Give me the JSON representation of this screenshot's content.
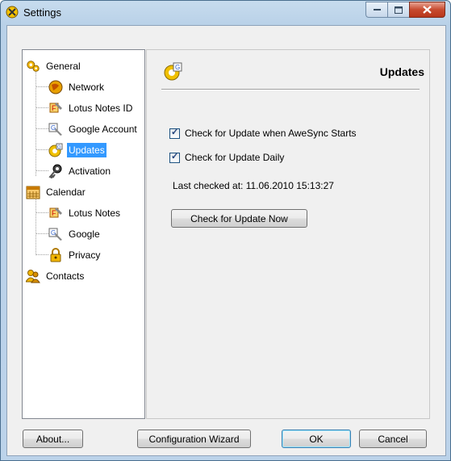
{
  "window": {
    "title": "Settings"
  },
  "caption": {
    "minimize": "–",
    "maximize": "□",
    "close": "✕"
  },
  "tree": {
    "items": [
      {
        "label": "General",
        "icon": "gears-icon"
      },
      {
        "label": "Network",
        "icon": "globe-icon"
      },
      {
        "label": "Lotus Notes ID",
        "icon": "lotus-tools-icon"
      },
      {
        "label": "Google Account",
        "icon": "google-tools-icon"
      },
      {
        "label": "Updates",
        "icon": "update-gear-icon",
        "selected": true
      },
      {
        "label": "Activation",
        "icon": "key-icon"
      },
      {
        "label": "Calendar",
        "icon": "calendar-icon"
      },
      {
        "label": "Lotus Notes",
        "icon": "lotus-tools-icon"
      },
      {
        "label": "Google",
        "icon": "google-tools-icon"
      },
      {
        "label": "Privacy",
        "icon": "lock-icon"
      },
      {
        "label": "Contacts",
        "icon": "contacts-icon"
      }
    ]
  },
  "panel": {
    "title": "Updates",
    "check_on_start": {
      "label": "Check for Update when AweSync Starts",
      "checked": true
    },
    "check_daily": {
      "label": "Check for Update Daily",
      "checked": true
    },
    "last_checked": "Last checked at: 11.06.2010 15:13:27",
    "check_now_label": "Check for Update Now"
  },
  "footer": {
    "about_label": "About...",
    "wizard_label": "Configuration Wizard",
    "ok_label": "OK",
    "cancel_label": "Cancel"
  },
  "colors": {
    "selection": "#3399ff",
    "accent_gear": "#f0c000"
  }
}
